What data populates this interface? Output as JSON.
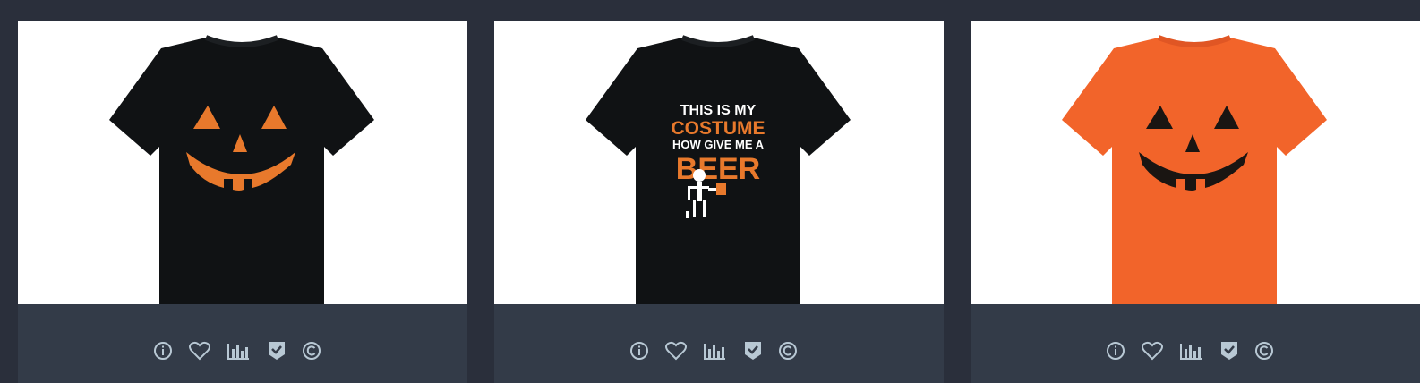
{
  "colors": {
    "page_bg": "#2a2f3b",
    "card_bg": "#333b48",
    "icon_color": "#b8c8d4",
    "shirt_black": "#101214",
    "shirt_orange": "#f2642a",
    "print_orange": "#e8792c"
  },
  "products": [
    {
      "shirt_color": "black",
      "design": "jack-o-lantern face, orange print",
      "print_text": []
    },
    {
      "shirt_color": "black",
      "design": "skeleton holding beer",
      "print_text": [
        "THIS IS MY",
        "COSTUME",
        "HOW GIVE ME A",
        "BEER"
      ]
    },
    {
      "shirt_color": "orange",
      "design": "jack-o-lantern face, black print",
      "print_text": []
    }
  ],
  "toolbar_icons": [
    "info-icon",
    "heart-icon",
    "bar-chart-icon",
    "shield-check-icon",
    "copyright-icon"
  ]
}
